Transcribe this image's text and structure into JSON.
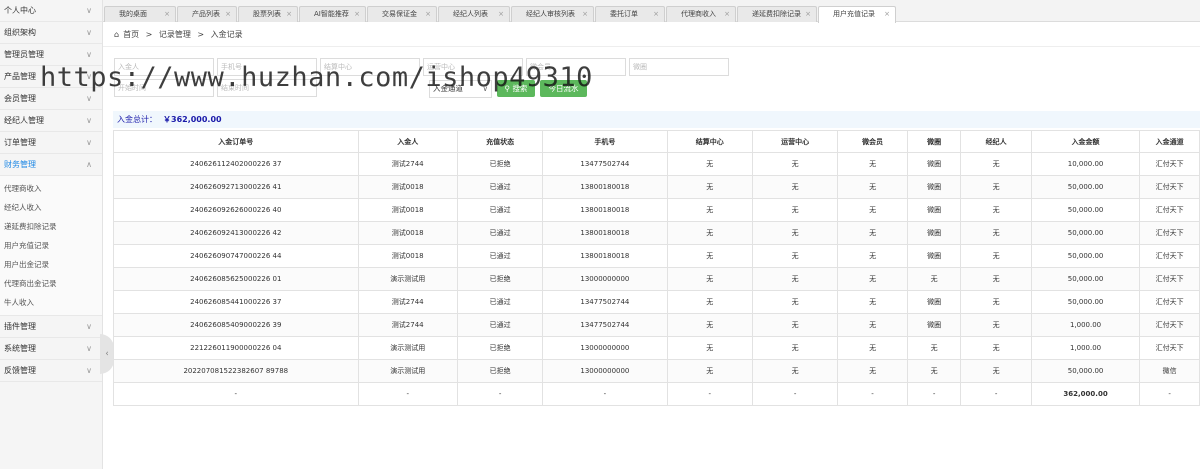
{
  "sidebar": {
    "items": [
      {
        "label": "个人中心",
        "chev": "∨"
      },
      {
        "label": "组织架构",
        "chev": "∨"
      },
      {
        "label": "管理员管理",
        "chev": "∨"
      },
      {
        "label": "产品管理",
        "chev": "∨"
      },
      {
        "label": "会员管理",
        "chev": "∨"
      },
      {
        "label": "经纪人管理",
        "chev": "∨"
      },
      {
        "label": "订单管理",
        "chev": "∨"
      },
      {
        "label": "财务管理",
        "chev": "∧"
      }
    ],
    "sub_items": [
      "代理商收入",
      "经纪人收入",
      "递延费扣除记录",
      "用户充值记录",
      "用户出金记录",
      "代理商出金记录",
      "牛人收入"
    ],
    "items_after": [
      {
        "label": "插件管理",
        "chev": "∨"
      },
      {
        "label": "系统管理",
        "chev": "∨"
      },
      {
        "label": "反馈管理",
        "chev": "∨"
      }
    ],
    "collapse_glyph": "‹"
  },
  "tabs": [
    "我的桌面",
    "产品列表",
    "股票列表",
    "AI智能推荐",
    "交易保证金",
    "经纪人列表",
    "经纪人审核列表",
    "委托订单",
    "代理商收入",
    "递延费扣除记录",
    "用户充值记录"
  ],
  "tab_close": "×",
  "breadcrumb": {
    "home_icon": "⌂",
    "home": "首页",
    "sep": ">",
    "level1": "记录管理",
    "level2": "入金记录"
  },
  "filters": {
    "row1": [
      "入金人",
      "手机号",
      "结算中心",
      "运营中心",
      "微会员",
      "微圈"
    ],
    "row2": [
      "开始时间",
      "结束时间"
    ],
    "channel_select": "入金通道",
    "search_button": "搜索",
    "search_icon": "search-icon",
    "today_button": "今日流水"
  },
  "summary": {
    "label": "入金总计：",
    "value": "￥362,000.00"
  },
  "table": {
    "headers": [
      "入金订单号",
      "入金人",
      "充值状态",
      "手机号",
      "结算中心",
      "运营中心",
      "微会员",
      "微圈",
      "经纪人",
      "入金金额",
      "入金通道"
    ],
    "rows": [
      [
        "240626112402000226 37",
        "测试2744",
        "已拒绝",
        "13477502744",
        "无",
        "无",
        "无",
        "微圈",
        "无",
        "10,000.00",
        "汇付天下"
      ],
      [
        "240626092713000226 41",
        "测试0018",
        "已通过",
        "13800180018",
        "无",
        "无",
        "无",
        "微圈",
        "无",
        "50,000.00",
        "汇付天下"
      ],
      [
        "240626092626000226 40",
        "测试0018",
        "已通过",
        "13800180018",
        "无",
        "无",
        "无",
        "微圈",
        "无",
        "50,000.00",
        "汇付天下"
      ],
      [
        "240626092413000226 42",
        "测试0018",
        "已通过",
        "13800180018",
        "无",
        "无",
        "无",
        "微圈",
        "无",
        "50,000.00",
        "汇付天下"
      ],
      [
        "240626090747000226 44",
        "测试0018",
        "已通过",
        "13800180018",
        "无",
        "无",
        "无",
        "微圈",
        "无",
        "50,000.00",
        "汇付天下"
      ],
      [
        "240626085625000226 01",
        "演示测试用",
        "已拒绝",
        "13000000000",
        "无",
        "无",
        "无",
        "无",
        "无",
        "50,000.00",
        "汇付天下"
      ],
      [
        "240626085441000226 37",
        "测试2744",
        "已通过",
        "13477502744",
        "无",
        "无",
        "无",
        "微圈",
        "无",
        "50,000.00",
        "汇付天下"
      ],
      [
        "240626085409000226 39",
        "测试2744",
        "已通过",
        "13477502744",
        "无",
        "无",
        "无",
        "微圈",
        "无",
        "1,000.00",
        "汇付天下"
      ],
      [
        "221226011900000226 04",
        "演示测试用",
        "已拒绝",
        "13000000000",
        "无",
        "无",
        "无",
        "无",
        "无",
        "1,000.00",
        "汇付天下"
      ],
      [
        "202207081522382607 89788",
        "演示测试用",
        "已拒绝",
        "13000000000",
        "无",
        "无",
        "无",
        "无",
        "无",
        "50,000.00",
        "微信"
      ],
      [
        "-",
        "-",
        "-",
        "-",
        "-",
        "-",
        "-",
        "-",
        "-",
        "362,000.00",
        "-"
      ]
    ]
  },
  "watermark": "https://www.huzhan.com/ishop49310"
}
